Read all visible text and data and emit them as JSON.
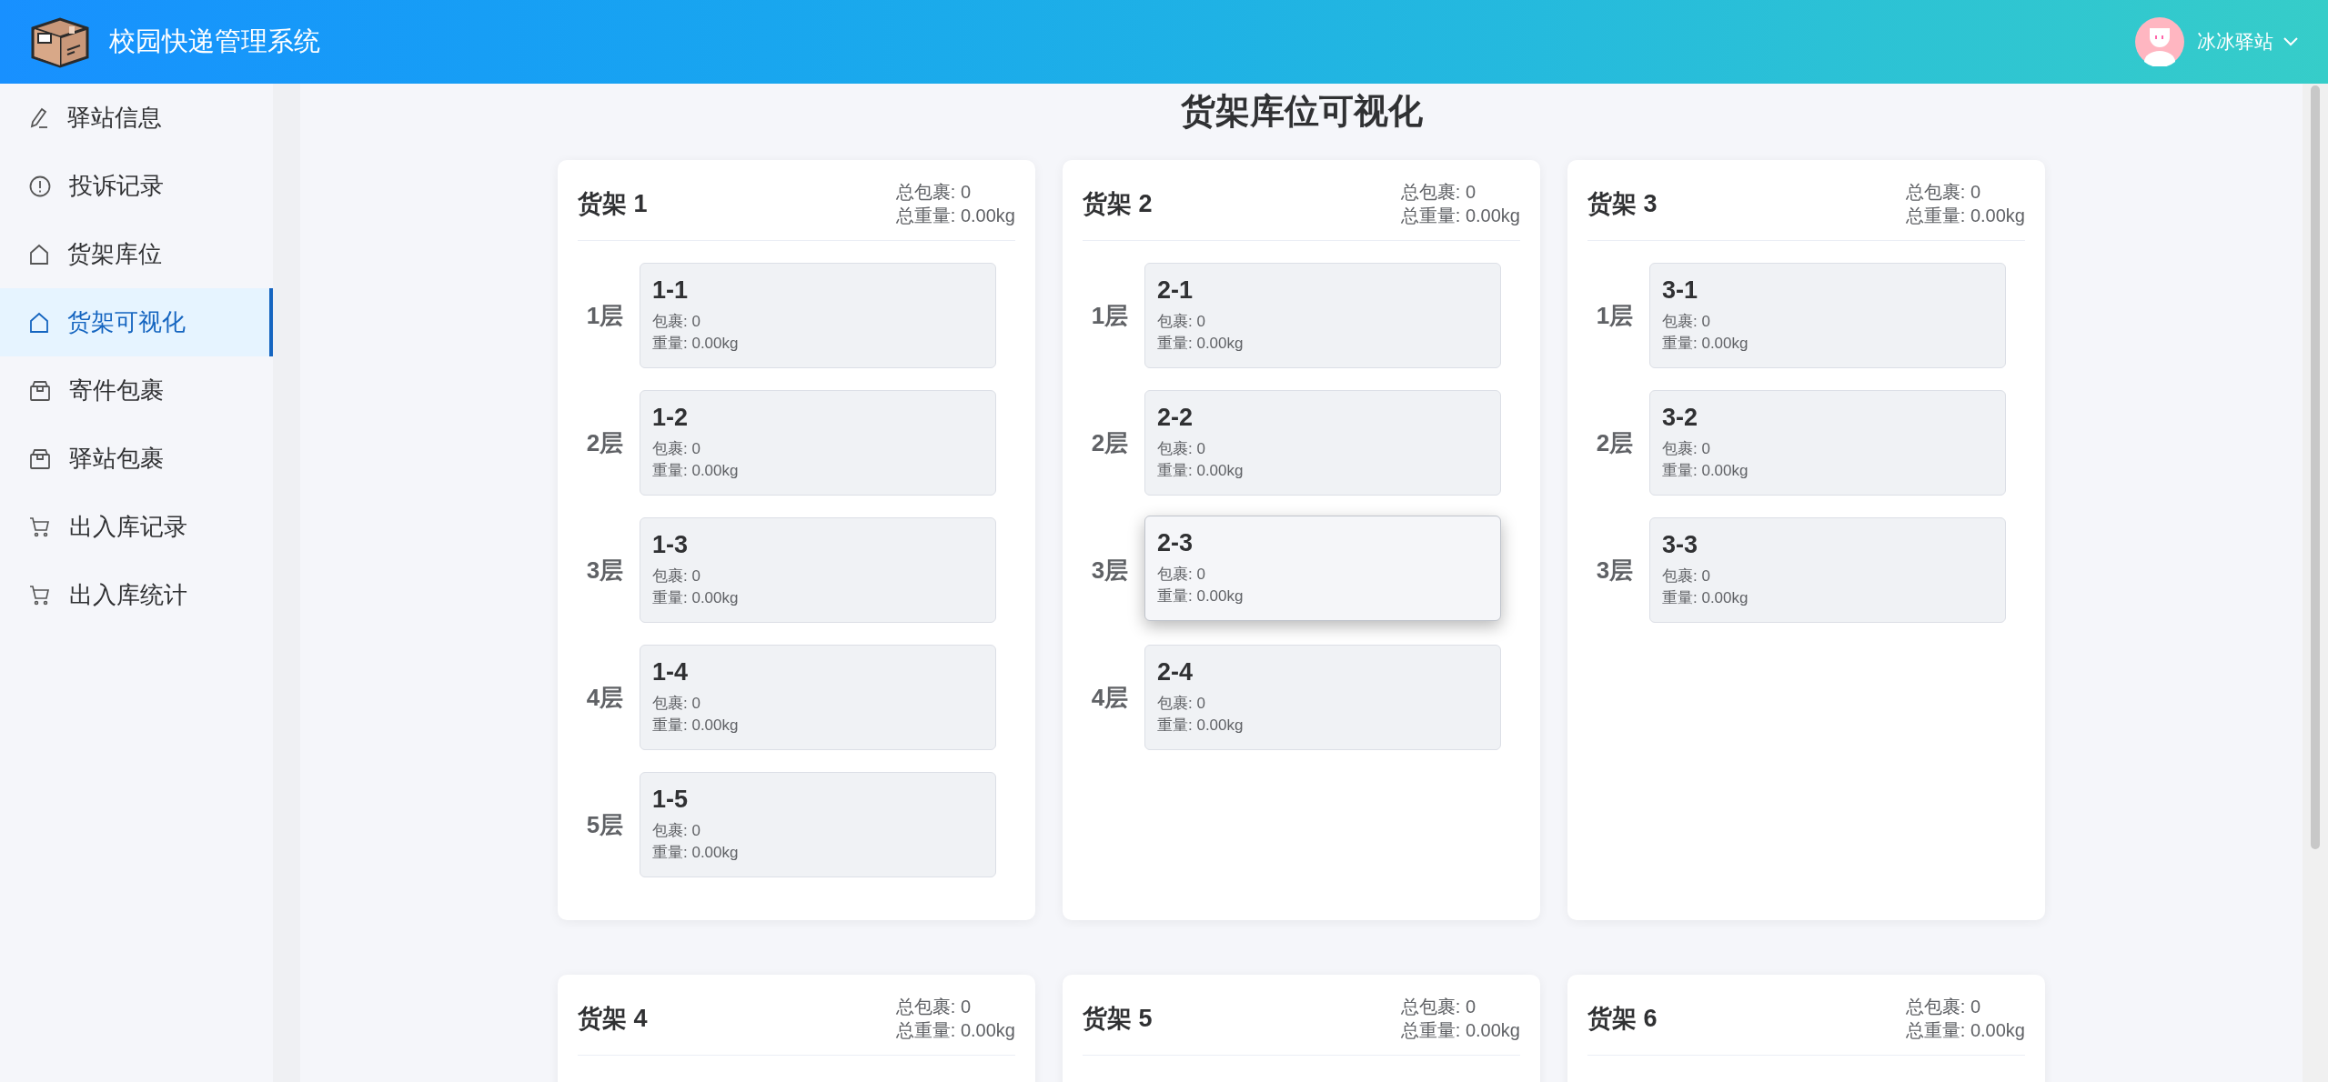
{
  "header": {
    "title": "校园快递管理系统",
    "user": "冰冰驿站"
  },
  "sidebar": {
    "items": [
      {
        "label": "驿站信息",
        "selected": false
      },
      {
        "label": "投诉记录",
        "selected": false
      },
      {
        "label": "货架库位",
        "selected": false
      },
      {
        "label": "货架可视化",
        "selected": true
      },
      {
        "label": "寄件包裹",
        "selected": false
      },
      {
        "label": "驿站包裹",
        "selected": false
      },
      {
        "label": "出入库记录",
        "selected": false
      },
      {
        "label": "出入库统计",
        "selected": false
      }
    ]
  },
  "page_title": "货架库位可视化",
  "shelves": [
    {
      "name": "货架 1",
      "total_count": "总包裹: 0",
      "total_weight": "总重量: 0.00kg",
      "levels": [
        {
          "floor": "1层",
          "slot": "1-1",
          "count": "包裹: 0",
          "weight": "重量: 0.00kg",
          "hovered": false
        },
        {
          "floor": "2层",
          "slot": "1-2",
          "count": "包裹: 0",
          "weight": "重量: 0.00kg",
          "hovered": false
        },
        {
          "floor": "3层",
          "slot": "1-3",
          "count": "包裹: 0",
          "weight": "重量: 0.00kg",
          "hovered": false
        },
        {
          "floor": "4层",
          "slot": "1-4",
          "count": "包裹: 0",
          "weight": "重量: 0.00kg",
          "hovered": false
        },
        {
          "floor": "5层",
          "slot": "1-5",
          "count": "包裹: 0",
          "weight": "重量: 0.00kg",
          "hovered": false
        }
      ]
    },
    {
      "name": "货架 2",
      "total_count": "总包裹: 0",
      "total_weight": "总重量: 0.00kg",
      "levels": [
        {
          "floor": "1层",
          "slot": "2-1",
          "count": "包裹: 0",
          "weight": "重量: 0.00kg",
          "hovered": false
        },
        {
          "floor": "2层",
          "slot": "2-2",
          "count": "包裹: 0",
          "weight": "重量: 0.00kg",
          "hovered": false
        },
        {
          "floor": "3层",
          "slot": "2-3",
          "count": "包裹: 0",
          "weight": "重量: 0.00kg",
          "hovered": true
        },
        {
          "floor": "4层",
          "slot": "2-4",
          "count": "包裹: 0",
          "weight": "重量: 0.00kg",
          "hovered": false
        }
      ]
    },
    {
      "name": "货架 3",
      "total_count": "总包裹: 0",
      "total_weight": "总重量: 0.00kg",
      "levels": [
        {
          "floor": "1层",
          "slot": "3-1",
          "count": "包裹: 0",
          "weight": "重量: 0.00kg",
          "hovered": false
        },
        {
          "floor": "2层",
          "slot": "3-2",
          "count": "包裹: 0",
          "weight": "重量: 0.00kg",
          "hovered": false
        },
        {
          "floor": "3层",
          "slot": "3-3",
          "count": "包裹: 0",
          "weight": "重量: 0.00kg",
          "hovered": false
        }
      ]
    },
    {
      "name": "货架 4",
      "total_count": "总包裹: 0",
      "total_weight": "总重量: 0.00kg"
    },
    {
      "name": "货架 5",
      "total_count": "总包裹: 0",
      "total_weight": "总重量: 0.00kg"
    },
    {
      "name": "货架 6",
      "total_count": "总包裹: 0",
      "total_weight": "总重量: 0.00kg"
    }
  ]
}
